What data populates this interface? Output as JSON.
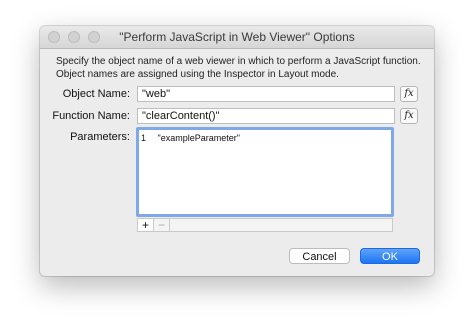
{
  "window": {
    "title": "\"Perform JavaScript in Web Viewer\" Options"
  },
  "description": "Specify the object name of a web viewer in which to perform a JavaScript function. Object names are assigned using the Inspector in Layout mode.",
  "fields": {
    "object_name_label": "Object Name:",
    "object_name_value": "\"web\"",
    "function_name_label": "Function Name:",
    "function_name_value": "\"clearContent()\"",
    "fx_label": "fx"
  },
  "parameters": {
    "label": "Parameters:",
    "rows": [
      {
        "number": "1",
        "value": "\"exampleParameter\""
      }
    ],
    "add_label": "+",
    "remove_label": "−"
  },
  "buttons": {
    "cancel": "Cancel",
    "ok": "OK"
  },
  "colors": {
    "accent": "#1d75f2",
    "focus_ring": "#7fa8e8"
  }
}
